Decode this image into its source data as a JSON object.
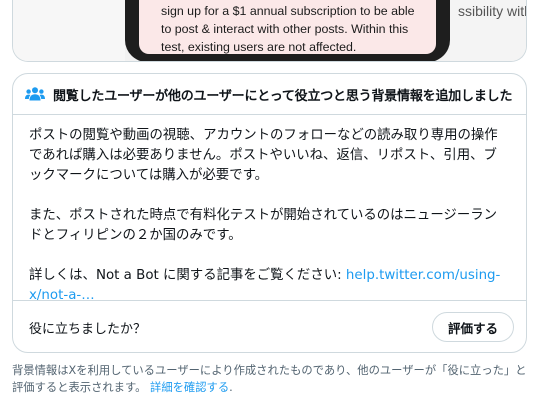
{
  "media": {
    "screen_text": "sign up for a $1 annual subscription to be able to post & interact with other posts. Within this test, existing users are not affected.",
    "right_text": "ssibility with th"
  },
  "note": {
    "icon": "people-icon",
    "title": "閲覧したユーザーが他のユーザーにとって役立つと思う背景情報を追加しました",
    "paragraph1": "ポストの閲覧や動画の視聴、アカウントのフォローなどの読み取り専用の操作であれば購入は必要ありません。ポストやいいね、返信、リポスト、引用、ブックマークについては購入が必要です。",
    "paragraph2": "また、ポストされた時点で有料化テストが開始されているのはニュージーランドとフィリピンの２か国のみです。",
    "paragraph3_prefix": "詳しくは、Not a Bot に関する記事をご覧ください: ",
    "paragraph3_link": "help.twitter.com/using-x/not-a-…",
    "helpful_question": "役に立ちましたか？",
    "rate_button": "評価する"
  },
  "disclaimer": {
    "text": "背景情報はXを利用しているユーザーにより作成されたものであり、他のユーザーが「役に立った」と評価すると表示されます。 ",
    "link": "詳細を確認する",
    "suffix": "."
  },
  "colors": {
    "link": "#1d9bf0",
    "border": "#cfd9de",
    "muted": "#536471",
    "icon": "#1d9bf0"
  }
}
